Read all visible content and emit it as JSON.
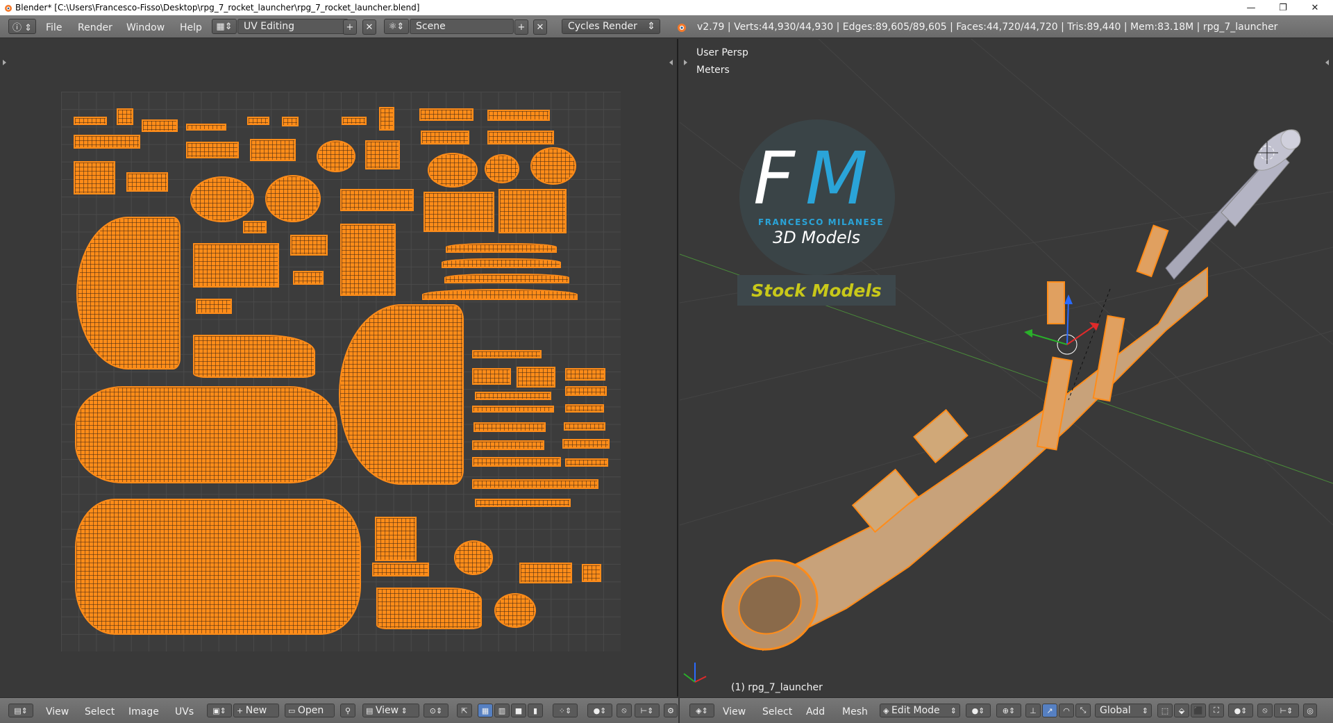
{
  "window": {
    "title": "Blender* [C:\\Users\\Francesco-Fisso\\Desktop\\rpg_7_rocket_launcher\\rpg_7_rocket_launcher.blend]",
    "minimize": "—",
    "restore": "❐",
    "close": "✕"
  },
  "infobar": {
    "menus": [
      "File",
      "Render",
      "Window",
      "Help"
    ],
    "screen_layout": "UV Editing",
    "scene": "Scene",
    "render_engine": "Cycles Render",
    "stats": "v2.79 | Verts:44,930/44,930 | Edges:89,605/89,605 | Faces:44,720/44,720 | Tris:89,440 | Mem:83.18M | rpg_7_launcher"
  },
  "uv_editor": {
    "footer": {
      "menus": [
        "View",
        "Select",
        "Image",
        "UVs"
      ],
      "new_label": "New",
      "open_label": "Open",
      "view_label": "View"
    }
  },
  "viewport": {
    "view_name": "User Persp",
    "units": "Meters",
    "object_name": "(1) rpg_7_launcher",
    "watermark": {
      "logo_f": "F",
      "logo_m": "M",
      "author": "FRANCESCO MILANESE",
      "subtitle": "3D Models",
      "badge": "Stock Models"
    },
    "footer": {
      "menus": [
        "View",
        "Select",
        "Add",
        "Mesh"
      ],
      "mode": "Edit Mode",
      "orientation": "Global"
    }
  },
  "colors": {
    "uv_wire": "#ff8c19",
    "logo_blue": "#2aa4d8",
    "badge_yellow": "#c8c81a",
    "header_gray": "#727272"
  }
}
